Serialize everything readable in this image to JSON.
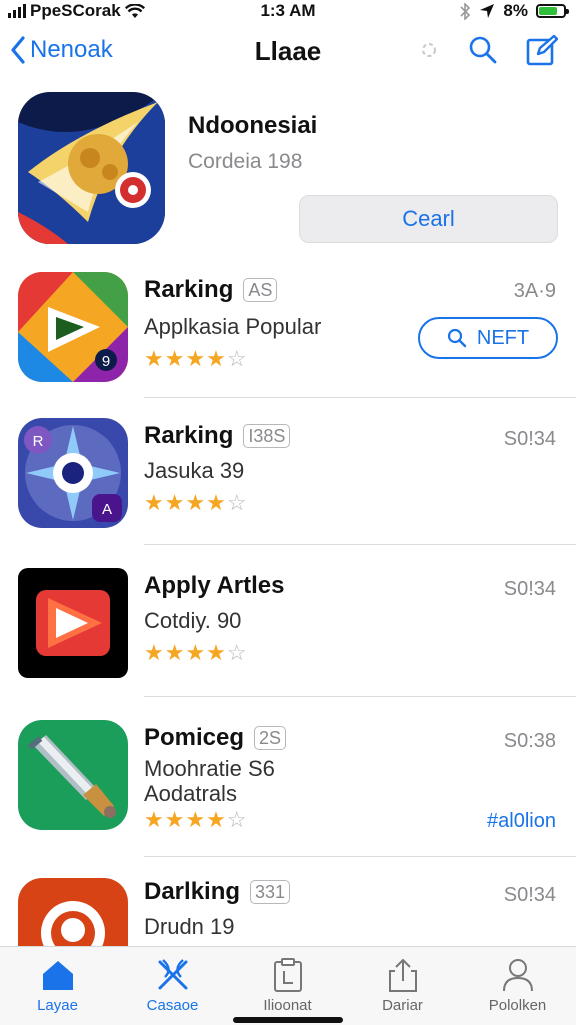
{
  "status": {
    "carrier": "PpeSCorak",
    "time": "1:3 AM",
    "battery": "8%"
  },
  "nav": {
    "back_label": "Nenoak",
    "title": "Llaae"
  },
  "featured": {
    "title": "Ndoonesiai",
    "subtitle": "Cordeia 198",
    "button": "Cearl"
  },
  "apps": [
    {
      "title": "Rarking",
      "badge": "AS",
      "subtitle": "Applkasia Popular",
      "rating": 4,
      "meta": "3A·9",
      "button": "NEFT"
    },
    {
      "title": "Rarking",
      "badge": "I38S",
      "subtitle": "Jasuka 39",
      "rating": 4,
      "meta": "S0!34"
    },
    {
      "title": "Apply Artles",
      "subtitle": "Cotdiy. 90",
      "rating": 4,
      "meta": "S0!34"
    },
    {
      "title": "Pomiceg",
      "badge": "2S",
      "subtitle": "Moohratie S6",
      "subtitle2": "Aodatrals",
      "rating": 4,
      "meta": "S0:38",
      "link": "#al0lion"
    },
    {
      "title": "Darlking",
      "badge": "331",
      "subtitle": "Drudn 19",
      "meta": "S0!34"
    }
  ],
  "tabs": [
    {
      "label": "Layae",
      "icon": "home-icon",
      "active": true
    },
    {
      "label": "Casaoe",
      "icon": "tools-icon"
    },
    {
      "label": "Ilioonat",
      "icon": "clipboard-icon"
    },
    {
      "label": "Dariar",
      "icon": "share-icon"
    },
    {
      "label": "Pololken",
      "icon": "person-icon"
    }
  ],
  "colors": {
    "accent": "#1a73e8",
    "star": "#f5a623"
  }
}
